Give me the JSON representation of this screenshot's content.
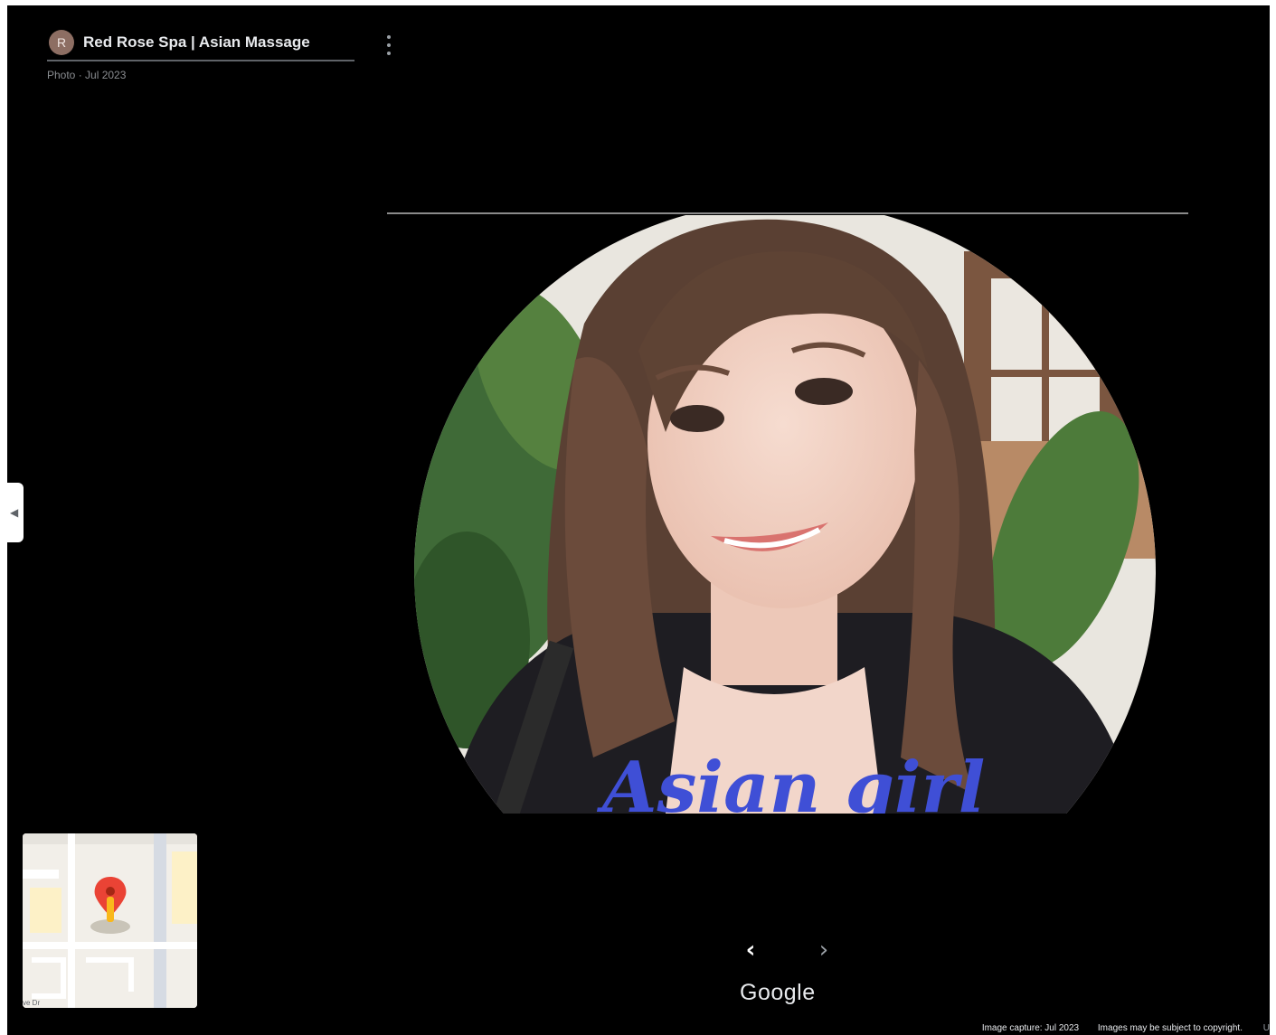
{
  "header": {
    "avatar_letter": "R",
    "place_title": "Red Rose Spa | Asian Massage",
    "subtitle": "Photo · Jul 2023"
  },
  "icons": {
    "more": "more-vertical-icon",
    "collapse": "chevron-left-icon",
    "prev": "chevron-left-icon",
    "next": "chevron-right-icon",
    "map_pin": "map-pin-icon"
  },
  "photo": {
    "caption": "Asian girl"
  },
  "mini_map": {
    "label": "ve Dr"
  },
  "navigation": {
    "prev_symbol": "‹",
    "next_symbol": "›"
  },
  "branding": {
    "logo": "Google"
  },
  "footer": {
    "capture": "Image capture: Jul 2023",
    "copyright": "Images may be subject to copyright.",
    "trailing": "U"
  },
  "colors": {
    "background": "#000000",
    "caption": "#3f4fd6",
    "pin": "#ea4335"
  }
}
